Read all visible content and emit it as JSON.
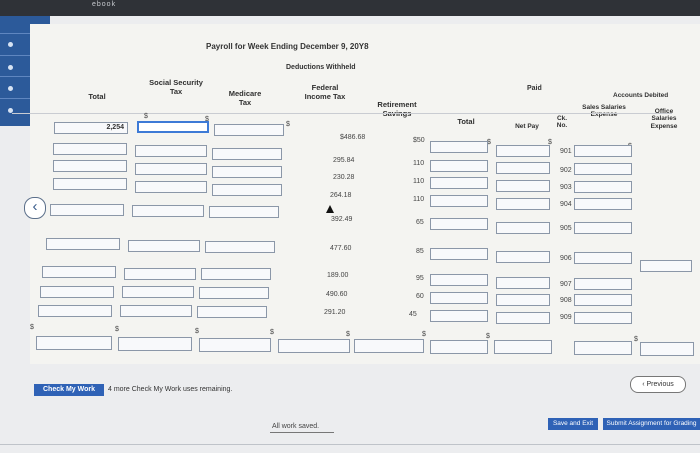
{
  "browser": {
    "top_label": "ebook"
  },
  "header": {
    "title": "Payroll for Week Ending December 9, 20Y8",
    "deductions": "Deductions Withheld",
    "paid": "Paid",
    "accounts_debited": "Accounts Debited"
  },
  "columns": {
    "total": "Total",
    "social_security": "Social Security Tax",
    "medicare": "Medicare Tax",
    "federal": "Federal Income Tax",
    "retirement": "Retirement Savings",
    "deductions_total": "Total",
    "net_pay": "Net Pay",
    "ck_no": "Ck. No.",
    "sales": "Sales Salaries Expense",
    "office": "Office Salaries Expense"
  },
  "rows": [
    {
      "total": "2,254",
      "federal": "$486.68",
      "retirement": "$50",
      "ck": "901"
    },
    {
      "federal": "295.84",
      "retirement": "110",
      "ck": "902"
    },
    {
      "federal": "230.28",
      "retirement": "110",
      "ck": "903"
    },
    {
      "federal": "264.18",
      "retirement": "110",
      "ck": "904"
    },
    {
      "federal": "392.49",
      "retirement": "65",
      "ck": "905"
    },
    {
      "federal": "477.60",
      "retirement": "85",
      "ck": "906"
    },
    {
      "federal": "189.00",
      "retirement": "95",
      "ck": "907"
    },
    {
      "federal": "490.60",
      "retirement": "60",
      "ck": "908"
    },
    {
      "federal": "291.20",
      "retirement": "45",
      "ck": "909"
    }
  ],
  "symbols": {
    "dollar": "$"
  },
  "footer": {
    "check_label": "Check My Work",
    "check_note": "4 more Check My Work uses remaining.",
    "previous": "Previous",
    "save": "Save and Exit",
    "submit": "Submit Assignment for Grading",
    "saved": "All work saved."
  },
  "nav": {
    "collapse_icon": "chevron-left-icon"
  }
}
